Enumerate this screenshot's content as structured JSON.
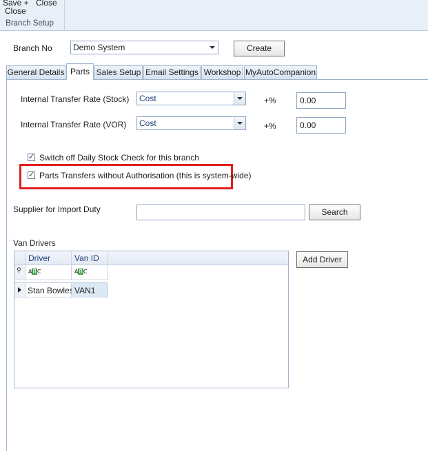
{
  "ribbon": {
    "save_close_line1": "Save +",
    "save_close_line2": "Close",
    "close_label": "Close",
    "group_label": "Branch Setup"
  },
  "branch": {
    "label": "Branch No",
    "value": "Demo System",
    "create_label": "Create"
  },
  "tabs": [
    {
      "label": "General Details"
    },
    {
      "label": "Parts"
    },
    {
      "label": "Sales Setup"
    },
    {
      "label": "Email Settings"
    },
    {
      "label": "Workshop"
    },
    {
      "label": "MyAutoCompanion"
    }
  ],
  "parts": {
    "transfer_stock": {
      "label": "Internal Transfer Rate (Stock)",
      "value": "Cost",
      "pct_label": "+%",
      "pct_value": "0.00"
    },
    "transfer_vor": {
      "label": "Internal Transfer Rate (VOR)",
      "value": "Cost",
      "pct_label": "+%",
      "pct_value": "0.00"
    },
    "daily_check": {
      "label": "Switch off Daily Stock Check for this branch",
      "checked": true
    },
    "no_auth": {
      "label": "Parts Transfers without Authorisation (this is system-wide)",
      "checked": true
    },
    "supplier_label": "Supplier for Import Duty",
    "supplier_value": "",
    "search_label": "Search",
    "van_drivers_label": "Van Drivers",
    "add_driver_label": "Add Driver",
    "grid": {
      "columns": [
        "Driver",
        "Van ID"
      ],
      "filter_icon": "abc-filter-icon",
      "rows": [
        {
          "driver": "Stan Bowles",
          "van_id": "VAN1"
        }
      ]
    }
  },
  "colors": {
    "highlight": "#e01e1e",
    "header_text": "#1e3f7a"
  }
}
